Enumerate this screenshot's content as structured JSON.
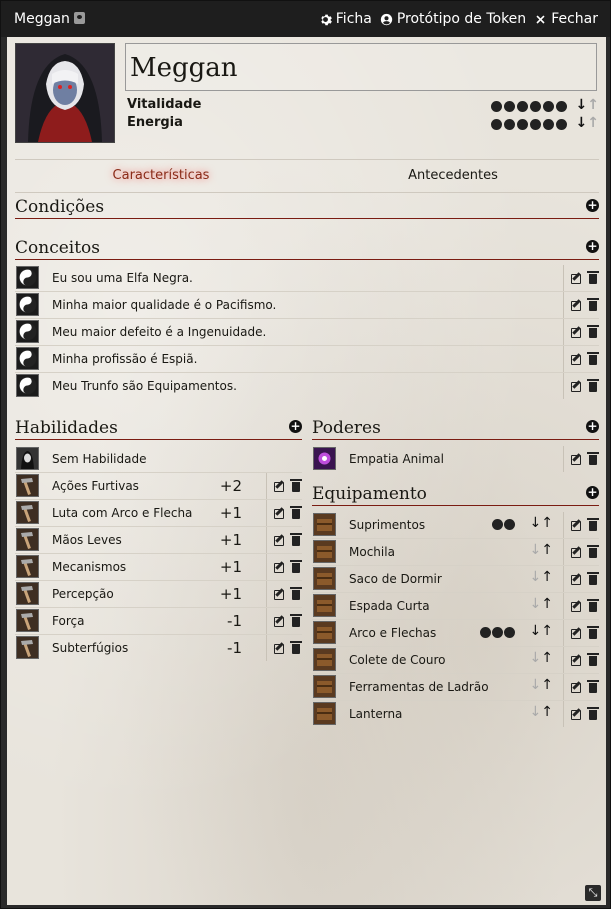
{
  "window": {
    "title": "Meggan",
    "actions": {
      "sheet": "Ficha",
      "token": "Protótipo de Token",
      "close": "Fechar"
    }
  },
  "character": {
    "name": "Meggan",
    "resources": [
      {
        "label": "Vitalidade",
        "value": 6,
        "max": 6
      },
      {
        "label": "Energia",
        "value": 6,
        "max": 6
      }
    ]
  },
  "tabs": [
    {
      "label": "Características",
      "active": true
    },
    {
      "label": "Antecedentes",
      "active": false
    }
  ],
  "sections": {
    "conditions": "Condições",
    "concepts": "Conceitos",
    "skills": "Habilidades",
    "powers": "Poderes",
    "equipment": "Equipamento"
  },
  "concepts": [
    "Eu sou uma Elfa Negra.",
    "Minha maior qualidade é o Pacifismo.",
    "Meu maior defeito é a Ingenuidade.",
    "Minha profissão é Espiã.",
    "Meu Trunfo são Equipamentos."
  ],
  "skills": [
    {
      "name": "Sem Habilidade",
      "mod": "",
      "icon": "portrait-icon"
    },
    {
      "name": "Ações Furtivas",
      "mod": "+2",
      "icon": "hammer-icon"
    },
    {
      "name": "Luta com Arco e Flecha",
      "mod": "+1",
      "icon": "hammer-icon"
    },
    {
      "name": "Mãos Leves",
      "mod": "+1",
      "icon": "hammer-icon"
    },
    {
      "name": "Mecanismos",
      "mod": "+1",
      "icon": "hammer-icon"
    },
    {
      "name": "Percepção",
      "mod": "+1",
      "icon": "hammer-icon"
    },
    {
      "name": "Força",
      "mod": "-1",
      "icon": "hammer-icon"
    },
    {
      "name": "Subterfúgios",
      "mod": "-1",
      "icon": "hammer-icon"
    }
  ],
  "powers": [
    {
      "name": "Empatia Animal"
    }
  ],
  "equipment": [
    {
      "name": "Suprimentos",
      "uses": 2
    },
    {
      "name": "Mochila",
      "uses": 0
    },
    {
      "name": "Saco de Dormir",
      "uses": 0
    },
    {
      "name": "Espada Curta",
      "uses": 0
    },
    {
      "name": "Arco e Flechas",
      "uses": 3
    },
    {
      "name": "Colete de Couro",
      "uses": 0
    },
    {
      "name": "Ferramentas de Ladrão",
      "uses": 0
    },
    {
      "name": "Lanterna",
      "uses": 0
    }
  ],
  "colors": {
    "accent_tab": "#8a2b18",
    "section_rule": "#7a1c12",
    "titlebar": "#1e1e1e"
  }
}
